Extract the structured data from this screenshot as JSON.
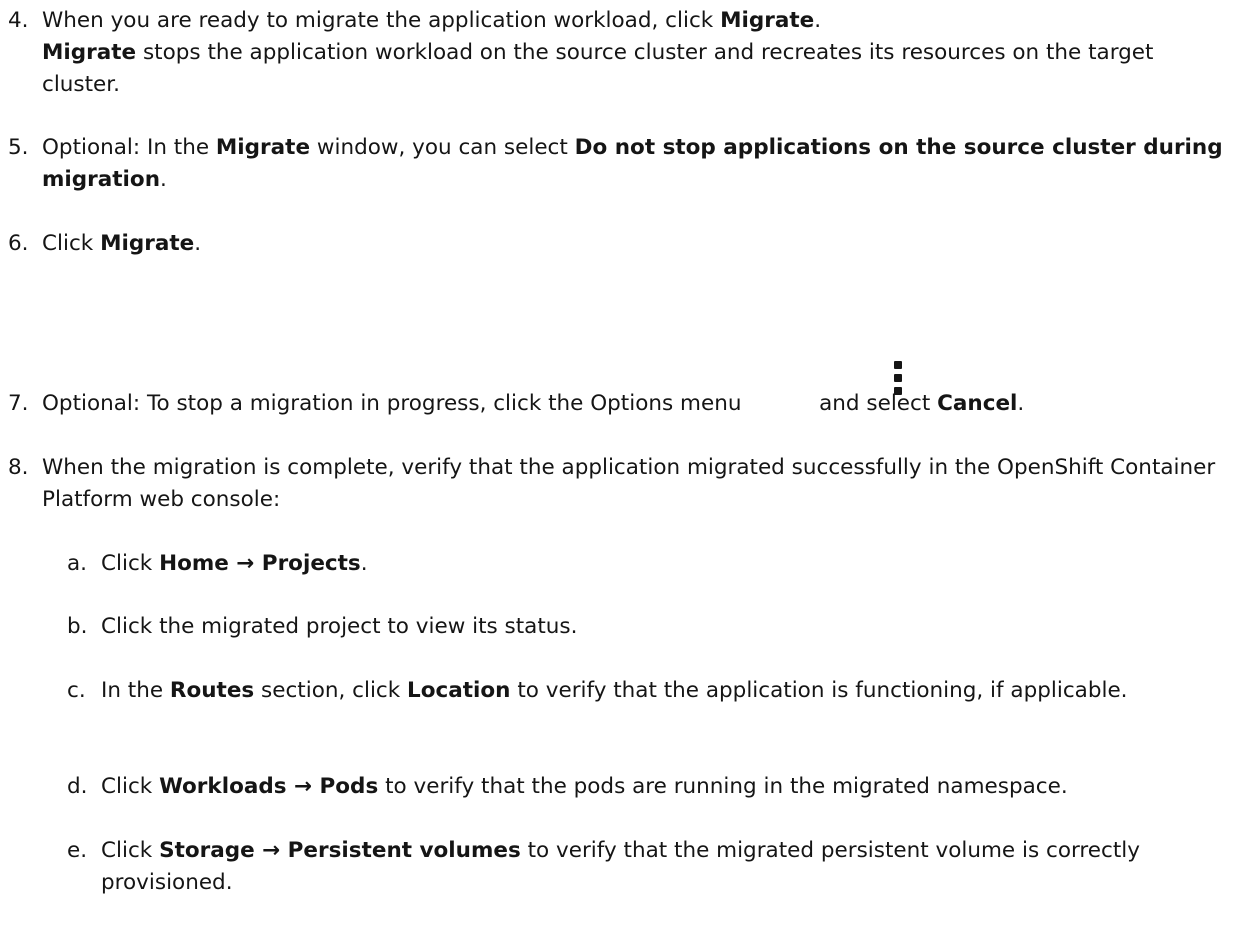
{
  "steps": [
    {
      "num": "4.",
      "text1": "When you are ready to migrate the application workload, click ",
      "bold1": "Migrate",
      "text2": ".",
      "line2_bold": "Migrate",
      "line2_text": " stops the application workload on the source cluster and recreates its resources on the target cluster."
    },
    {
      "num": "5.",
      "text1": "Optional: In the ",
      "bold1": "Migrate",
      "text2": " window, you can select ",
      "bold2": "Do not stop applications on the source cluster during migration",
      "text3": "."
    },
    {
      "num": "6.",
      "text1": "Click ",
      "bold1": "Migrate",
      "text2": "."
    },
    {
      "num": "7.",
      "text1": "Optional: To stop a migration in progress, click the Options menu ",
      "text2": " and select ",
      "bold1": "Cancel",
      "text3": "."
    },
    {
      "num": "8.",
      "text1": "When the migration is complete, verify that the application migrated successfully in the OpenShift Container Platform web console:"
    }
  ],
  "substeps": [
    {
      "letter": "a.",
      "text1": "Click ",
      "bold1": "Home → Projects",
      "text2": "."
    },
    {
      "letter": "b.",
      "text1": "Click the migrated project to view its status."
    },
    {
      "letter": "c.",
      "text1": "In the ",
      "bold1": "Routes",
      "text2": " section, click ",
      "bold2": "Location",
      "text3": " to verify that the application is functioning, if applicable."
    },
    {
      "letter": "d.",
      "text1": "Click ",
      "bold1": "Workloads → Pods",
      "text2": " to verify that the pods are running in the migrated namespace."
    },
    {
      "letter": "e.",
      "text1": "Click ",
      "bold1": "Storage → Persistent volumes",
      "text2": " to verify that the migrated persistent volume is correctly provisioned."
    }
  ],
  "icons": {
    "options_menu": "kebab-vertical-icon"
  }
}
